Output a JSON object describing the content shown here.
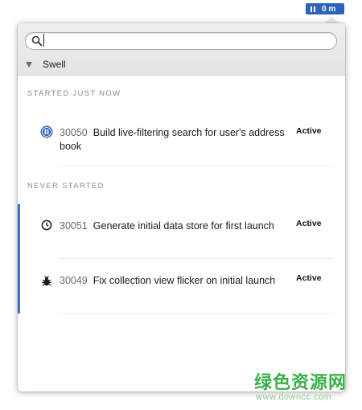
{
  "menubar": {
    "timer": "0 m",
    "icon": "pause-icon",
    "accent": "#2d63b8"
  },
  "search": {
    "value": "",
    "placeholder": "",
    "icon": "search-icon"
  },
  "project": {
    "name": "Swell",
    "icon": "disclosure-triangle-icon"
  },
  "sections": [
    {
      "title": "STARTED JUST NOW",
      "items": [
        {
          "icon": "pause-circle-icon",
          "number": "30050",
          "title": "Build live-filtering search for user's address book",
          "status": "Active"
        }
      ]
    },
    {
      "title": "NEVER STARTED",
      "items": [
        {
          "icon": "clock-icon",
          "number": "30051",
          "title": "Generate initial data store for first launch",
          "status": "Active"
        },
        {
          "icon": "bug-icon",
          "number": "30049",
          "title": "Fix collection view flicker on initial launch",
          "status": "Active"
        }
      ]
    }
  ],
  "watermark": {
    "text": "绿色资源网",
    "url": "www.downcc.com"
  }
}
